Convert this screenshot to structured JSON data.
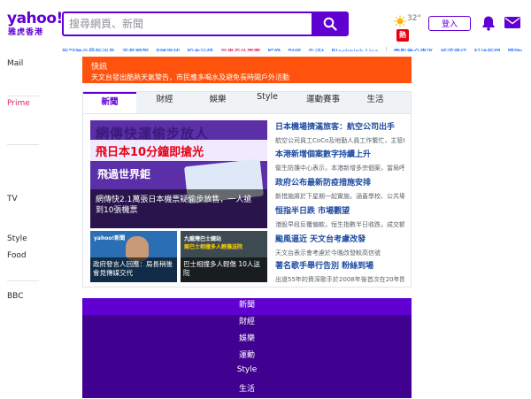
{
  "header": {
    "logo_word": "yahoo!",
    "logo_sub": "雅虎香港",
    "search_placeholder": "搜尋網頁、新聞",
    "weather_temp": "32°",
    "weather_badge": "熱",
    "signin_label": "登入"
  },
  "trending": [
    {
      "label": "新冠肺炎最新消息",
      "hot": false
    },
    {
      "label": "天氣預報",
      "hot": false
    },
    {
      "label": "8號風球",
      "hot": false
    },
    {
      "label": "股市行情",
      "hot": false
    },
    {
      "label": "世界盃外圍賽",
      "hot": true
    },
    {
      "label": "娛樂",
      "hot": false
    },
    {
      "label": "財經",
      "hot": false
    },
    {
      "label": "生活t",
      "hot": false
    },
    {
      "label": "Blackpink Lisa",
      "hot": false
    },
    {
      "label": "電影推介專區",
      "hot": false
    },
    {
      "label": "旅遊資訊",
      "hot": false
    },
    {
      "label": "科技新聞",
      "hot": false
    },
    {
      "label": "購物優惠推介",
      "hot": false
    },
    {
      "label": "美食",
      "hot": false
    }
  ],
  "leftnav": {
    "items": [
      "Mail",
      "Prime",
      "TV",
      "Style",
      "Food",
      "BBC"
    ]
  },
  "alert": {
    "title": "快訊",
    "message": "天文台發出酷熱天氣警告，市民應多喝水及避免長時間戶外活動"
  },
  "news": {
    "tabs": [
      "新聞",
      "財經",
      "娛樂",
      "Style",
      "運動賽事",
      "生活"
    ],
    "hero": {
      "headline_1": "網傳快運偷步放人",
      "headline_2": "飛日本10分鐘即搶光",
      "headline_3": "飛過世界鉅",
      "caption": "網傳快2.1萬張日本機票疑偷步放售，一人搶到10張機票"
    },
    "thumbs": [
      {
        "logo": "yahoo!新聞",
        "caption": "政府發言人回應：局長稍後會見傳媒交代",
        "label": "",
        "label2": ""
      },
      {
        "logo": "",
        "caption": "巴士相撞多人輕傷 10人送院",
        "label": "九龍灣巴士總站",
        "label2": "兩巴士相撞多人輕傷送院"
      }
    ],
    "stories": [
      {
        "headline": "日本機場擠滿旅客：航空公司出手",
        "summary": "航空公司員工CoCo及地勤人員工作繁忙，主管Bruce表示..."
      },
      {
        "headline": "本港新增個案數字持續上升",
        "summary": "衞生防護中心表示，本港新增多宗個案，當局呼籲市民保持警覺及注意個人衞生"
      },
      {
        "headline": "政府公布最新防疫措施安排",
        "summary": "新措施將於下星期一起實施，涵蓋學校、公共場所及交通運輸等多方面的安排"
      },
      {
        "headline": "恒指半日跌 市場觀望",
        "summary": "港股早段反覆偏軟，恒生指數半日收跌，成交額較上日減少，科技股普遍下跌"
      },
      {
        "headline": "颱風逼近 天文台考慮改發",
        "summary": "天文台表示會考慮於今晚改發較高信號"
      },
      {
        "headline": "著名歌手舉行告別 粉絲到場",
        "summary": "出道55年的資深歌手於2008年後首次在20年間舉行演唱會"
      }
    ]
  },
  "menu": {
    "items": [
      "新聞",
      "財經",
      "娛樂",
      "運動",
      "Style",
      "生活"
    ]
  },
  "colors": {
    "brand": "#6001d2",
    "alert": "#ff520d",
    "menu": "#400090",
    "link": "#1d4ba0",
    "prime": "#e0245e"
  }
}
